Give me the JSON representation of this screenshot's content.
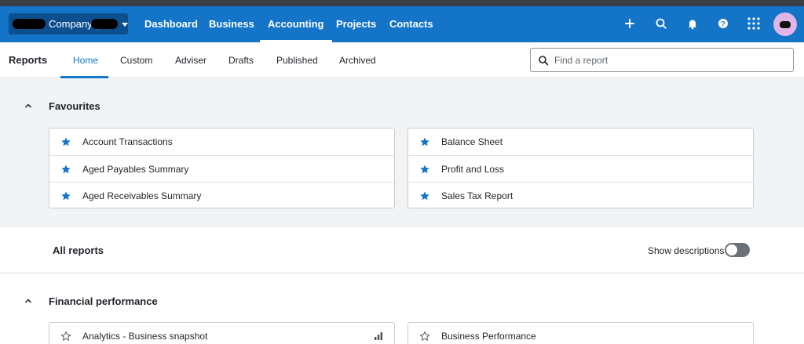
{
  "nav": {
    "org_name": "Company (",
    "links": [
      "Dashboard",
      "Business",
      "Accounting",
      "Projects",
      "Contacts"
    ],
    "active_link": "Accounting",
    "icons": [
      "plus-icon",
      "search-icon",
      "bell-icon",
      "help-icon",
      "app-grid-icon"
    ]
  },
  "reports_nav": {
    "title": "Reports",
    "tabs": [
      "Home",
      "Custom",
      "Adviser",
      "Drafts",
      "Published",
      "Archived"
    ],
    "active_tab": "Home",
    "search_placeholder": "Find a report"
  },
  "favourites": {
    "heading": "Favourites",
    "left": [
      "Account Transactions",
      "Aged Payables Summary",
      "Aged Receivables Summary"
    ],
    "right": [
      "Balance Sheet",
      "Profit and Loss",
      "Sales Tax Report"
    ]
  },
  "all_reports": {
    "heading": "All reports",
    "show_descriptions_label": "Show descriptions",
    "show_descriptions_on": false
  },
  "financial_performance": {
    "heading": "Financial performance",
    "left": [
      "Analytics - Business snapshot"
    ],
    "right": [
      "Business Performance"
    ]
  },
  "colors": {
    "brand_blue": "#1374c8",
    "star_blue": "#1374c8"
  }
}
